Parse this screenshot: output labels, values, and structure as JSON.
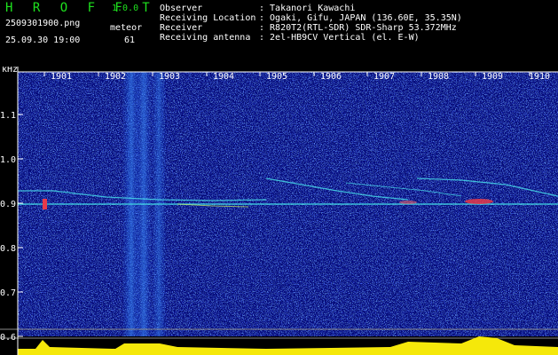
{
  "header": {
    "app_title": "H R O F F T",
    "version": "1.0.0",
    "file_name": "2509301900.png",
    "datetime": "25.09.30 19:00",
    "meteor_label": "meteor",
    "meteor_count": "61",
    "info": [
      {
        "key": "Observer",
        "value": ": Takanori Kawachi"
      },
      {
        "key": "Receiving Location",
        "value": ": Ogaki, Gifu, JAPAN (136.60E, 35.35N)"
      },
      {
        "key": "Receiver",
        "value": ": R820T2(RTL-SDR) SDR-Sharp 53.372MHz"
      },
      {
        "key": "Receiving antenna",
        "value": ": 2el-HB9CV Vertical (el. E-W)"
      }
    ]
  },
  "axis": {
    "unit": "kHz",
    "y_ticks": [
      "1.1",
      "1.0",
      "0.9",
      "0.8",
      "0.7",
      "0.6"
    ],
    "x_ticks": [
      "1901",
      "1902",
      "1903",
      "1904",
      "1905",
      "1906",
      "1907",
      "1908",
      "1909",
      "1910"
    ]
  },
  "colors": {
    "header_green": "#1ee21e",
    "background": "#050a7a",
    "signal": "#46d8e8",
    "meteor": "#e83a4a",
    "level_yellow": "#f5e80a",
    "level_cyan": "#29c8f0"
  }
}
